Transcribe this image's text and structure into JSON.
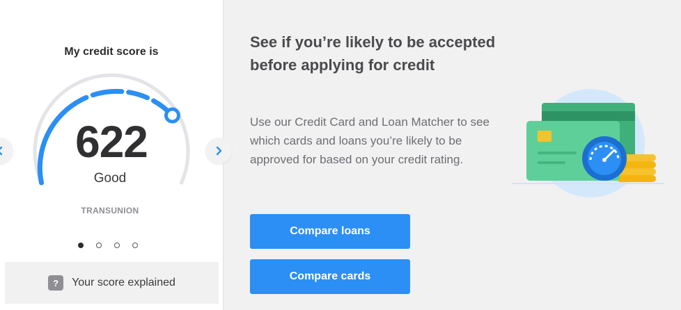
{
  "score_panel": {
    "title": "My credit score is",
    "score": "622",
    "band": "Good",
    "bureau": "TRANSUNION",
    "pagination": {
      "total": 4,
      "active": 1
    },
    "explain_label": "Your score explained",
    "explain_icon_text": "?",
    "arrows": {
      "prev_icon": "chevron-left-icon",
      "next_icon": "chevron-right-icon"
    }
  },
  "promo": {
    "headline": "See if you’re likely to be accepted before applying for credit",
    "description": "Use our Credit Card and Loan Matcher to see which cards and loans you’re likely to be approved for based on your credit rating.",
    "buttons": {
      "compare_loans": "Compare loans",
      "compare_cards": "Compare cards"
    },
    "illustration": "credit-cards-speedometer-illustration"
  },
  "colors": {
    "accent": "#2b8ff5",
    "gauge_track": "#e3e4e7",
    "card_green": "#5fcf9a",
    "card_green_back": "#3fb07a",
    "coin_gold": "#f6c22d",
    "background": "#f1f1f2"
  }
}
